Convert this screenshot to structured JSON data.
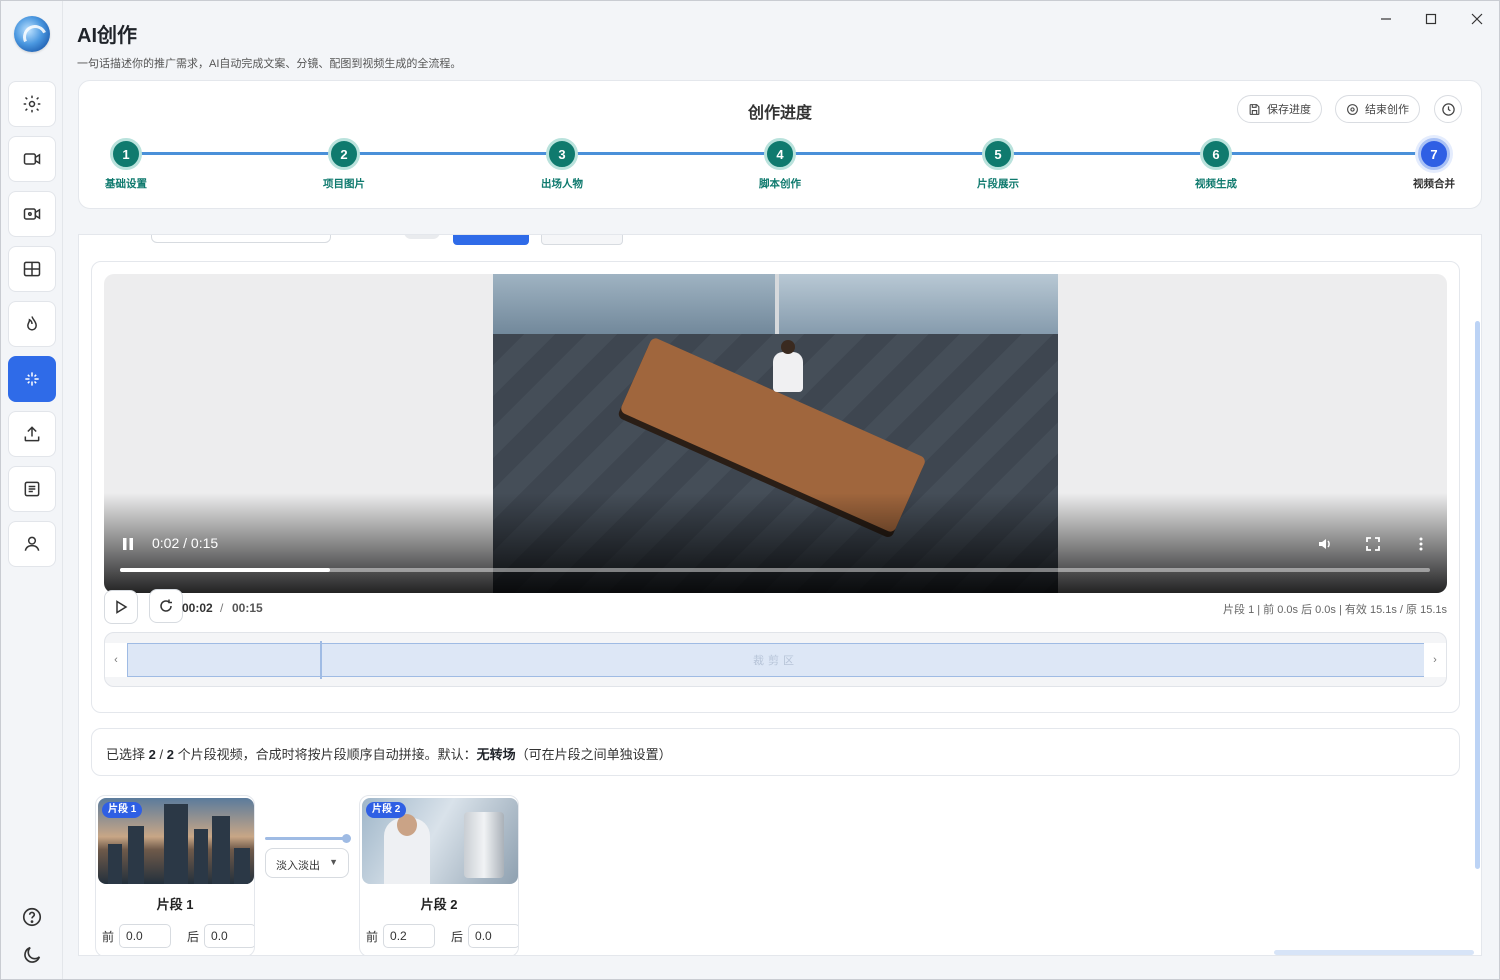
{
  "app": {
    "title": "AI创作",
    "subtitle": "一句话描述你的推广需求，AI自动完成文案、分镜、配图到视频生成的全流程。"
  },
  "sidebar": {
    "items": [
      {
        "icon": "gear-icon"
      },
      {
        "icon": "video-camera-icon"
      },
      {
        "icon": "video-record-icon"
      },
      {
        "icon": "grid-icon"
      },
      {
        "icon": "flame-icon"
      },
      {
        "icon": "sparkle-icon",
        "active": true
      },
      {
        "icon": "upload-icon"
      },
      {
        "icon": "document-icon"
      },
      {
        "icon": "user-icon"
      }
    ],
    "bottom": [
      {
        "icon": "help-icon"
      },
      {
        "icon": "moon-icon"
      }
    ]
  },
  "progress": {
    "title": "创作进度",
    "save_label": "保存进度",
    "end_label": "结束创作",
    "steps": [
      {
        "num": "1",
        "label": "基础设置"
      },
      {
        "num": "2",
        "label": "项目图片"
      },
      {
        "num": "3",
        "label": "出场人物"
      },
      {
        "num": "4",
        "label": "脚本创作"
      },
      {
        "num": "5",
        "label": "片段展示"
      },
      {
        "num": "6",
        "label": "视频生成"
      },
      {
        "num": "7",
        "label": "视频合并"
      }
    ],
    "current_step": 7
  },
  "player": {
    "time_display": "0:02 / 0:15",
    "progress": 0.16,
    "current": "00:02",
    "separator": "/",
    "total": "00:15",
    "segment_info": "片段 1 | 前 0.0s 后 0.0s | 有效 15.1s / 原 15.1s",
    "trim_zone_label": "裁剪区",
    "handle_left": "‹",
    "handle_right": "›"
  },
  "selection": {
    "prefix": "已选择",
    "selected": "2",
    "slash": "/",
    "total": "2",
    "middle": "个片段视频，合成时将按片段顺序自动拼接。默认：",
    "default_transition": "无转场",
    "suffix": "（可在片段之间单独设置）"
  },
  "clips": [
    {
      "badge": "片段 1",
      "name": "片段 1",
      "before_label": "前",
      "before": "0.0",
      "after_label": "后",
      "after": "0.0"
    },
    {
      "badge": "片段 2",
      "name": "片段 2",
      "before_label": "前",
      "before": "0.2",
      "after_label": "后",
      "after": "0.0"
    }
  ],
  "transition": {
    "selected": "淡入淡出"
  },
  "colors": {
    "accent": "#2f6be8",
    "step_done": "#0f7a6e",
    "step_current": "#2f5fe4"
  }
}
